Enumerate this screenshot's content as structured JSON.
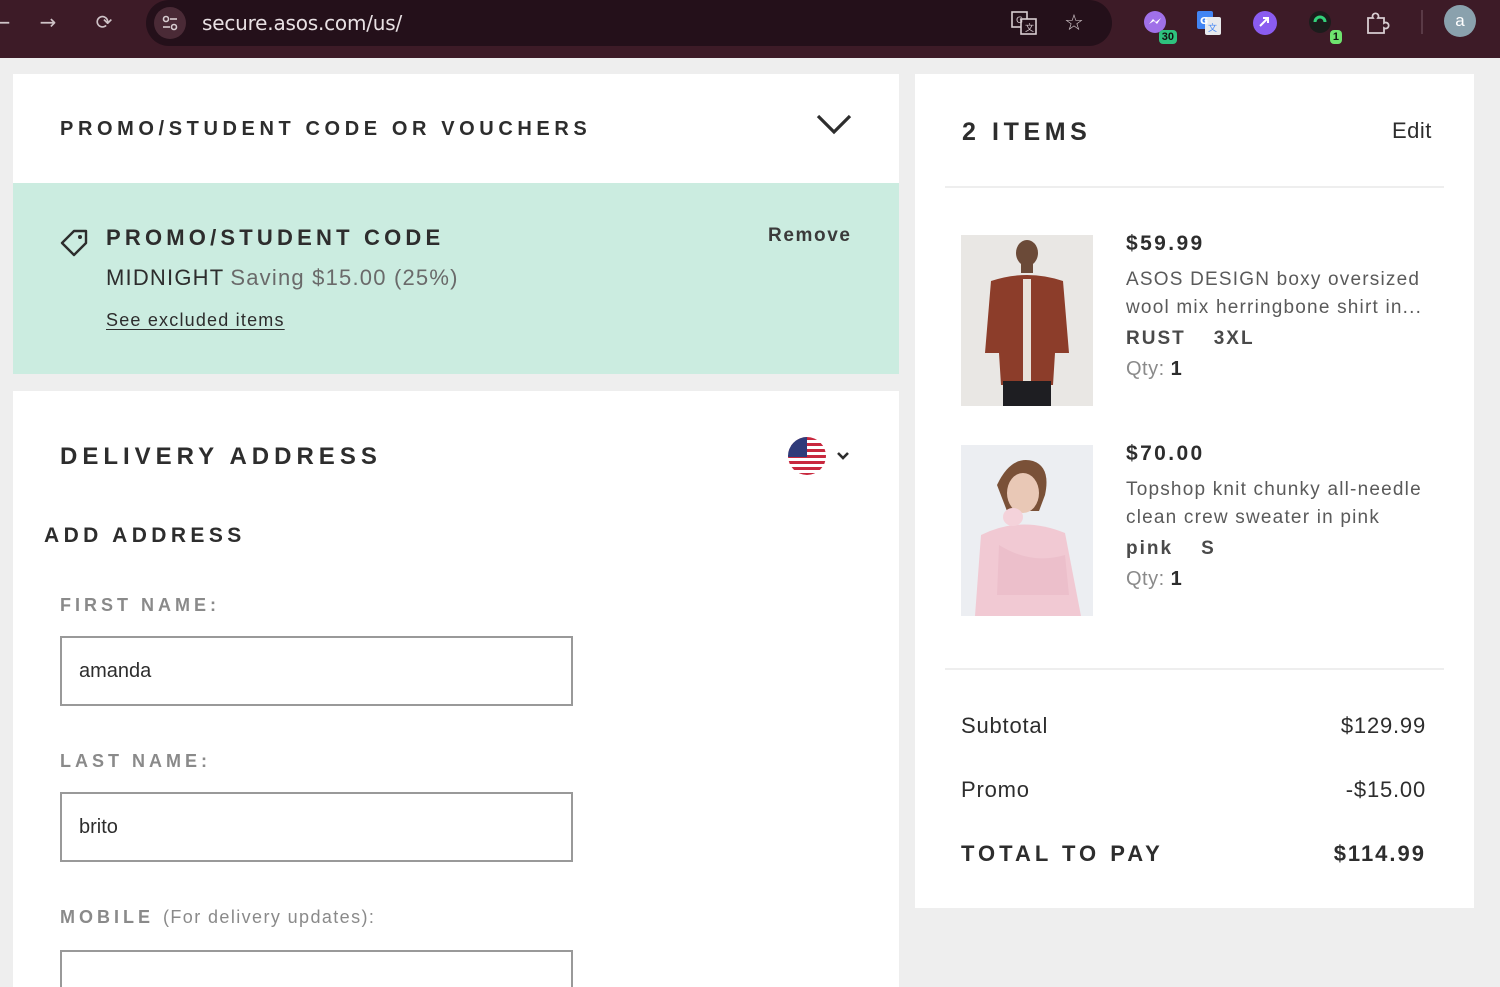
{
  "browser": {
    "url": "secure.asos.com/us/",
    "extensions": [
      {
        "icon": "messenger-extension-icon",
        "badge": "30"
      },
      {
        "icon": "google-translate-extension-icon",
        "badge": ""
      },
      {
        "icon": "purple-link-extension-icon",
        "badge": ""
      },
      {
        "icon": "green-shield-extension-icon",
        "badge": "1"
      }
    ],
    "profile_initial": "a"
  },
  "promo": {
    "section_title": "PROMO/STUDENT CODE OR VOUCHERS",
    "applied_title": "PROMO/STUDENT CODE",
    "remove_label": "Remove",
    "code": "MIDNIGHT",
    "saving_text": "Saving $15.00 (25%)",
    "excluded_link": "See excluded items"
  },
  "delivery": {
    "title": "DELIVERY ADDRESS",
    "country_flag": "us-flag-icon",
    "add_address_title": "ADD ADDRESS",
    "first_name_label": "FIRST NAME:",
    "first_name_value": "amanda",
    "last_name_label": "LAST NAME:",
    "last_name_value": "brito",
    "mobile_label": "MOBILE",
    "mobile_hint": "(For delivery updates):",
    "mobile_value": ""
  },
  "bag": {
    "title": "2 ITEMS",
    "edit_label": "Edit",
    "items": [
      {
        "price": "$59.99",
        "description": "ASOS DESIGN boxy oversized wool mix herringbone shirt in...",
        "color": "RUST",
        "size": "3XL",
        "qty_label": "Qty:",
        "qty": "1"
      },
      {
        "price": "$70.00",
        "description": "Topshop knit chunky all-needle clean crew sweater in pink",
        "color": "pink",
        "size": "S",
        "qty_label": "Qty:",
        "qty": "1"
      }
    ],
    "subtotal_label": "Subtotal",
    "subtotal_value": "$129.99",
    "promo_label": "Promo",
    "promo_value": "-$15.00",
    "total_label": "TOTAL TO PAY",
    "total_value": "$114.99"
  },
  "colors": {
    "chrome_bg": "#3d1b27",
    "promo_applied_bg": "#cbece0",
    "page_bg": "#eeeeee"
  }
}
